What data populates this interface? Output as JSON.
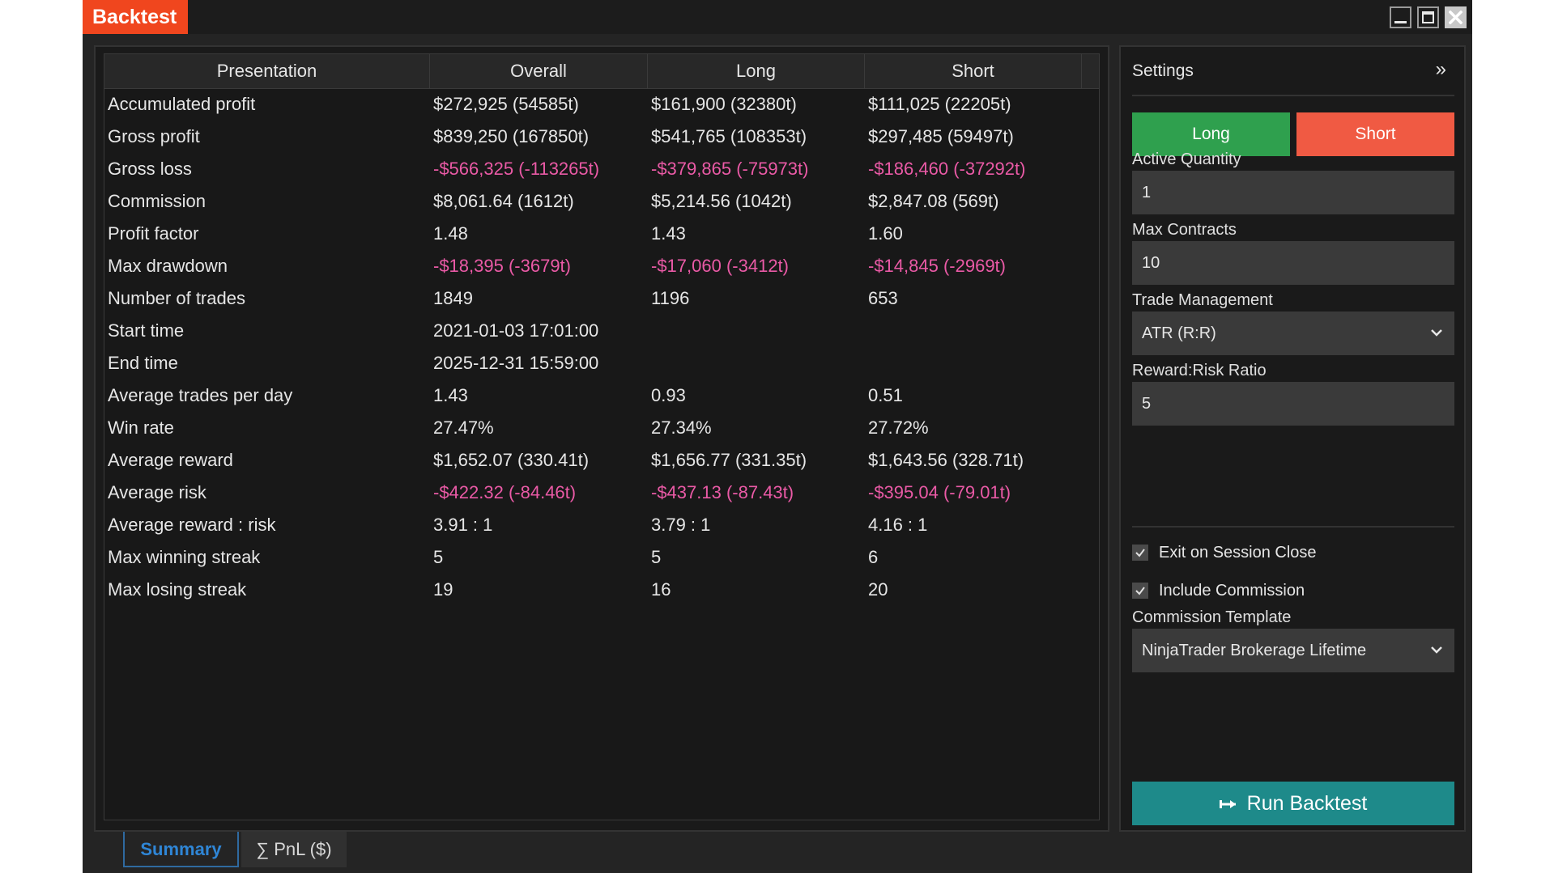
{
  "window": {
    "title": "Backtest"
  },
  "results": {
    "columns": [
      "Presentation",
      "Overall",
      "Long",
      "Short"
    ],
    "rows": [
      {
        "label": "Accumulated profit",
        "overall": "$272,925 (54585t)",
        "long": "$161,900 (32380t)",
        "short": "$111,025 (22205t)",
        "negative": false
      },
      {
        "label": "Gross profit",
        "overall": "$839,250 (167850t)",
        "long": "$541,765 (108353t)",
        "short": "$297,485 (59497t)",
        "negative": false
      },
      {
        "label": "Gross loss",
        "overall": "-$566,325 (-113265t)",
        "long": "-$379,865 (-75973t)",
        "short": "-$186,460 (-37292t)",
        "negative": true
      },
      {
        "label": "Commission",
        "overall": "$8,061.64 (1612t)",
        "long": "$5,214.56 (1042t)",
        "short": "$2,847.08 (569t)",
        "negative": false
      },
      {
        "label": "Profit factor",
        "overall": "1.48",
        "long": "1.43",
        "short": "1.60",
        "negative": false
      },
      {
        "label": "Max drawdown",
        "overall": "-$18,395 (-3679t)",
        "long": "-$17,060 (-3412t)",
        "short": "-$14,845 (-2969t)",
        "negative": true
      },
      {
        "label": "Number of trades",
        "overall": "1849",
        "long": "1196",
        "short": "653",
        "negative": false
      },
      {
        "label": "Start time",
        "overall": "2021-01-03 17:01:00",
        "long": "",
        "short": "",
        "negative": false
      },
      {
        "label": "End time",
        "overall": "2025-12-31 15:59:00",
        "long": "",
        "short": "",
        "negative": false
      },
      {
        "label": "Average trades per day",
        "overall": "1.43",
        "long": "0.93",
        "short": "0.51",
        "negative": false
      },
      {
        "label": "Win rate",
        "overall": "27.47%",
        "long": "27.34%",
        "short": "27.72%",
        "negative": false
      },
      {
        "label": "Average reward",
        "overall": "$1,652.07 (330.41t)",
        "long": "$1,656.77 (331.35t)",
        "short": "$1,643.56 (328.71t)",
        "negative": false
      },
      {
        "label": "Average risk",
        "overall": "-$422.32 (-84.46t)",
        "long": "-$437.13 (-87.43t)",
        "short": "-$395.04 (-79.01t)",
        "negative": true
      },
      {
        "label": "Average reward : risk",
        "overall": "3.91 : 1",
        "long": "3.79 : 1",
        "short": "4.16 : 1",
        "negative": false
      },
      {
        "label": "Max winning streak",
        "overall": "5",
        "long": "5",
        "short": "6",
        "negative": false
      },
      {
        "label": "Max losing streak",
        "overall": "19",
        "long": "16",
        "short": "20",
        "negative": false
      }
    ]
  },
  "tabs": {
    "summary": "Summary",
    "pnl": "∑ PnL ($)"
  },
  "settings": {
    "title": "Settings",
    "collapse_glyph": "»",
    "long_label": "Long",
    "short_label": "Short",
    "active_quantity_label": "Active Quantity",
    "active_quantity_value": "1",
    "max_contracts_label": "Max Contracts",
    "max_contracts_value": "10",
    "trade_management_label": "Trade Management",
    "trade_management_value": "ATR (R:R)",
    "reward_risk_label": "Reward:Risk Ratio",
    "reward_risk_value": "5",
    "exit_on_close_label": "Exit on Session Close",
    "exit_on_close_checked": true,
    "include_commission_label": "Include Commission",
    "include_commission_checked": true,
    "commission_template_label": "Commission Template",
    "commission_template_value": "NinjaTrader Brokerage Lifetime",
    "run_label": "Run Backtest"
  },
  "colors": {
    "accent_orange": "#f0461e",
    "long_green": "#2fa04e",
    "short_red": "#f05a43",
    "negative_pink": "#ea5aa6",
    "run_teal": "#1e8a8a",
    "tab_blue": "#2f86d6"
  },
  "icons": {
    "minimize": "minimize-icon",
    "maximize": "maximize-icon",
    "close": "close-icon",
    "collapse": "double-chevron-right-icon",
    "dropdown": "chevron-down-icon",
    "check": "check-icon",
    "run": "run-arrow-icon"
  }
}
